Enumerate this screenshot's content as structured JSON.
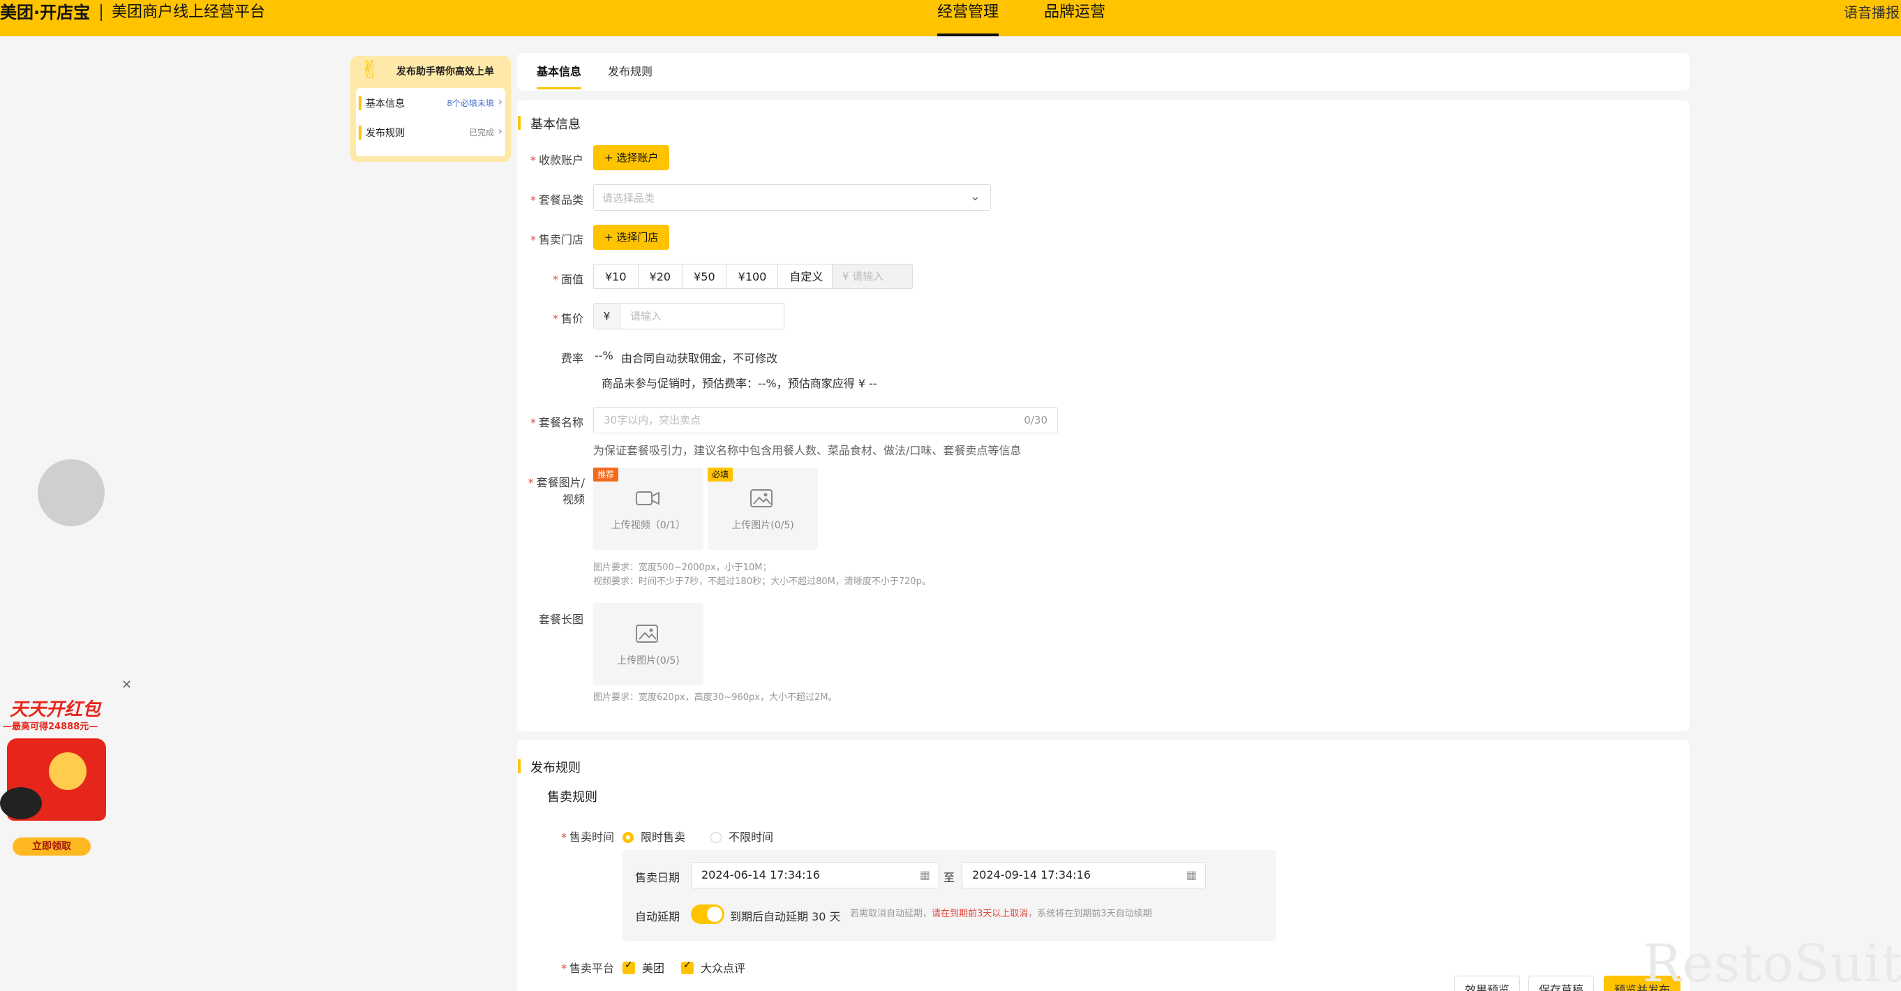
{
  "header": {
    "brand": "美团·开店宝",
    "platform": "美团商户线上经营平台",
    "nav": [
      "经营管理",
      "品牌运营"
    ],
    "voice": "语音播报"
  },
  "helper": {
    "title": "发布助手帮你高效上单",
    "items": [
      {
        "label": "基本信息",
        "status": "8个必填未填"
      },
      {
        "label": "发布规则",
        "status": "已完成"
      }
    ]
  },
  "tabs": [
    "基本信息",
    "发布规则"
  ],
  "basic": {
    "title": "基本信息",
    "account_label": "收款账户",
    "account_btn": "+ 选择账户",
    "category_label": "套餐品类",
    "category_placeholder": "请选择品类",
    "store_label": "售卖门店",
    "store_btn": "+ 选择门店",
    "face_label": "面值",
    "face_values": [
      "¥10",
      "¥20",
      "¥50",
      "¥100",
      "自定义"
    ],
    "face_custom_placeholder": "¥ 请输入",
    "price_label": "售价",
    "price_prefix": "¥",
    "price_placeholder": "请输入",
    "rate_label": "费率",
    "rate_value": "--%",
    "rate_note": "由合同自动获取佣金，不可修改",
    "rate_hint": "商品未参与促销时，预估费率：--%，预估商家应得 ¥ --",
    "name_label": "套餐名称",
    "name_placeholder": "30字以内，突出卖点",
    "name_count": "0/30",
    "name_hint": "为保证套餐吸引力，建议名称中包含用餐人数、菜品食材、做法/口味、套餐卖点等信息",
    "media_label_1": "套餐图片/",
    "media_label_2": "视频",
    "video_tag": "推荐",
    "video_label": "上传视频（0/1）",
    "image_tag": "必填",
    "image_label": "上传图片(0/5)",
    "media_req_1": "图片要求：宽度500~2000px，小于10M；",
    "media_req_2": "视频要求：时间不少于7秒，不超过180秒；大小不超过80M，清晰度不小于720p。",
    "long_label": "套餐长图",
    "long_upload": "上传图片(0/5)",
    "long_req": "图片要求：宽度620px，高度30~960px，大小不超过2M。"
  },
  "rules": {
    "title": "发布规则",
    "sub_title": "售卖规则",
    "time_label": "售卖时间",
    "opt_limited": "限时售卖",
    "opt_unlimited": "不限时间",
    "date_label": "售卖日期",
    "date_start": "2024-06-14 17:34:16",
    "date_sep": "至",
    "date_end": "2024-09-14 17:34:16",
    "auto_label": "自动延期",
    "auto_text": "到期后自动延期 30 天",
    "auto_hint_1": "若需取消自动延期，",
    "auto_hint_red": "请在到期前3天以上取消",
    "auto_hint_2": "，系统将在到期前3天自动续期",
    "platform_label": "售卖平台",
    "platform_1": "美团",
    "platform_2": "大众点评"
  },
  "footer": {
    "preview": "效果预览",
    "save": "保存草稿",
    "submit": "预览并发布"
  },
  "promo": {
    "title": "天天开红包",
    "subtitle": "—最高可得24888元—",
    "button": "立即领取",
    "close": "×"
  },
  "watermark": "RestoSuite",
  "colors": {
    "accent": "#ffc300",
    "required": "#e2483d",
    "link": "#4b6fd1"
  }
}
